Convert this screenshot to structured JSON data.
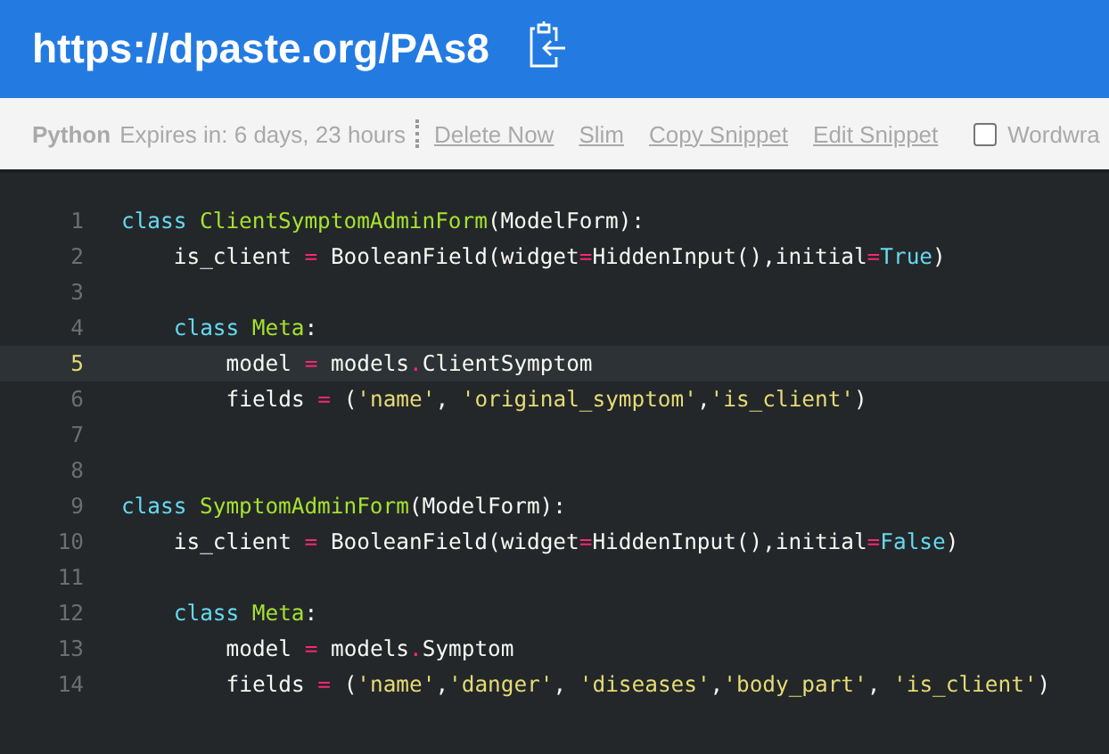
{
  "header": {
    "title": "https://dpaste.org/PAs8"
  },
  "toolbar": {
    "language": "Python",
    "expires": "Expires in: 6 days, 23 hours",
    "links": [
      "Delete Now",
      "Slim",
      "Copy Snippet",
      "Edit Snippet"
    ],
    "wordwrap": {
      "label": "Wordwra",
      "checked": false
    }
  },
  "code": [
    {
      "number": "1",
      "selected": false,
      "tokens": [
        {
          "kind": "keyword",
          "text": "class"
        },
        {
          "kind": "class",
          "text": "ClientSymptomAdminForm",
          "space_before": true
        },
        {
          "kind": "plain",
          "text": "(ModelForm):"
        }
      ],
      "children": [
        {
          "number": "2",
          "selected": false,
          "tokens": [
            {
              "kind": "plain",
              "text": "is_client"
            },
            {
              "kind": "operator",
              "text": "=",
              "space_before": true
            },
            {
              "kind": "plain",
              "text": "BooleanField(widget",
              "space_before": true
            },
            {
              "kind": "operator",
              "text": "="
            },
            {
              "kind": "plain",
              "text": "HiddenInput(),initial"
            },
            {
              "kind": "operator",
              "text": "="
            },
            {
              "kind": "constant",
              "text": "True"
            },
            {
              "kind": "plain",
              "text": ")"
            }
          ]
        },
        {
          "number": "3",
          "selected": false
        },
        {
          "number": "4",
          "selected": false,
          "tokens": [
            {
              "kind": "keyword",
              "text": "class"
            },
            {
              "kind": "class",
              "text": "Meta",
              "space_before": true
            },
            {
              "kind": "plain",
              "text": ":"
            }
          ],
          "children": [
            {
              "number": "5",
              "selected": true,
              "tokens": [
                {
                  "kind": "plain",
                  "text": "model"
                },
                {
                  "kind": "operator",
                  "text": "=",
                  "space_before": true
                },
                {
                  "kind": "plain",
                  "text": "models",
                  "space_before": true
                },
                {
                  "kind": "operator",
                  "text": "."
                },
                {
                  "kind": "plain",
                  "text": "ClientSymptom"
                }
              ]
            },
            {
              "number": "6",
              "selected": false,
              "tokens": [
                {
                  "kind": "plain",
                  "text": "fields"
                },
                {
                  "kind": "operator",
                  "text": "=",
                  "space_before": true
                },
                {
                  "kind": "plain",
                  "text": "(",
                  "space_before": true
                },
                {
                  "kind": "string",
                  "text": "'name'"
                },
                {
                  "kind": "plain",
                  "text": ","
                },
                {
                  "kind": "string",
                  "text": "'original_symptom'",
                  "space_before": true
                },
                {
                  "kind": "plain",
                  "text": ","
                },
                {
                  "kind": "string",
                  "text": "'is_client'"
                },
                {
                  "kind": "plain",
                  "text": ")"
                }
              ]
            }
          ]
        }
      ]
    },
    {
      "number": "7",
      "selected": false
    },
    {
      "number": "8",
      "selected": false
    },
    {
      "number": "9",
      "selected": false,
      "tokens": [
        {
          "kind": "keyword",
          "text": "class"
        },
        {
          "kind": "class",
          "text": "SymptomAdminForm",
          "space_before": true
        },
        {
          "kind": "plain",
          "text": "(ModelForm):"
        }
      ],
      "children": [
        {
          "number": "10",
          "selected": false,
          "tokens": [
            {
              "kind": "plain",
              "text": "is_client"
            },
            {
              "kind": "operator",
              "text": "=",
              "space_before": true
            },
            {
              "kind": "plain",
              "text": "BooleanField(widget",
              "space_before": true
            },
            {
              "kind": "operator",
              "text": "="
            },
            {
              "kind": "plain",
              "text": "HiddenInput(),initial"
            },
            {
              "kind": "operator",
              "text": "="
            },
            {
              "kind": "constant",
              "text": "False"
            },
            {
              "kind": "plain",
              "text": ")"
            }
          ]
        },
        {
          "number": "11",
          "selected": false
        },
        {
          "number": "12",
          "selected": false,
          "tokens": [
            {
              "kind": "keyword",
              "text": "class"
            },
            {
              "kind": "class",
              "text": "Meta",
              "space_before": true
            },
            {
              "kind": "plain",
              "text": ":"
            }
          ],
          "children": [
            {
              "number": "13",
              "selected": false,
              "tokens": [
                {
                  "kind": "plain",
                  "text": "model"
                },
                {
                  "kind": "operator",
                  "text": "=",
                  "space_before": true
                },
                {
                  "kind": "plain",
                  "text": "models",
                  "space_before": true
                },
                {
                  "kind": "operator",
                  "text": "."
                },
                {
                  "kind": "plain",
                  "text": "Symptom"
                }
              ]
            },
            {
              "number": "14",
              "selected": false,
              "tokens": [
                {
                  "kind": "plain",
                  "text": "fields"
                },
                {
                  "kind": "operator",
                  "text": "=",
                  "space_before": true
                },
                {
                  "kind": "plain",
                  "text": "(",
                  "space_before": true
                },
                {
                  "kind": "string",
                  "text": "'name'"
                },
                {
                  "kind": "plain",
                  "text": ","
                },
                {
                  "kind": "string",
                  "text": "'danger'"
                },
                {
                  "kind": "plain",
                  "text": ","
                },
                {
                  "kind": "string",
                  "text": "'diseases'",
                  "space_before": true
                },
                {
                  "kind": "plain",
                  "text": ","
                },
                {
                  "kind": "string",
                  "text": "'body_part'"
                },
                {
                  "kind": "plain",
                  "text": ","
                },
                {
                  "kind": "string",
                  "text": "'is_client'",
                  "space_before": true
                },
                {
                  "kind": "plain",
                  "text": ")"
                }
              ]
            }
          ]
        }
      ]
    }
  ]
}
